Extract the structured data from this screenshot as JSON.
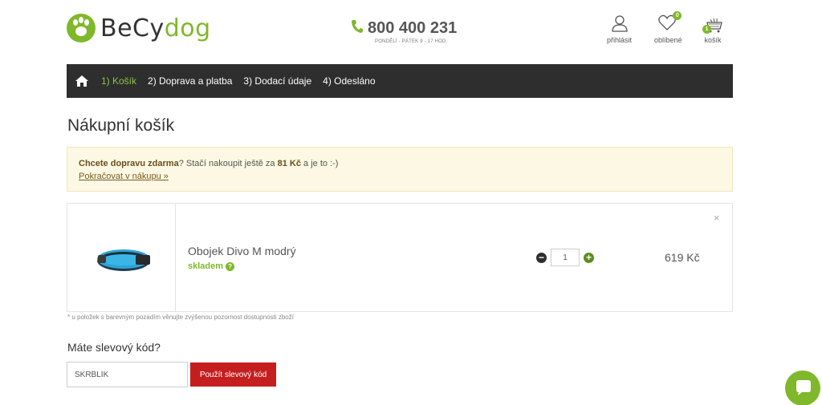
{
  "header": {
    "logo": {
      "text_main": "BeCy",
      "text_accent": "dog"
    },
    "phone": {
      "number": "800 400 231",
      "hours": "PONDĚLÍ - PÁTEK 9 - 17 HOD."
    },
    "user_nav": {
      "login_label": "přihlásit",
      "favorites_label": "oblíbené",
      "favorites_count": "0",
      "cart_label": "košík",
      "cart_count": "1"
    }
  },
  "steps": [
    "1) Košík",
    "2) Doprava a platba",
    "3) Dodací údaje",
    "4) Odesláno"
  ],
  "page_title": "Nákupní košík",
  "notice": {
    "bold_text": "Chcete dopravu zdarma",
    "text_before_amount": "? Stačí nakoupit ještě za ",
    "amount": "81 Kč",
    "text_after_amount": " a je to :-)",
    "link": "Pokračovat v nákupu »"
  },
  "cart": {
    "items": [
      {
        "name": "Obojek Divo M modrý",
        "stock": "skladem",
        "quantity": "1",
        "price": "619 Kč"
      }
    ],
    "remove_symbol": "×"
  },
  "availability_note": "* u položek s barevným pozadím věnujte zvýšenou pozornost dostupnosti zboží",
  "coupon": {
    "title": "Máte slevový kód?",
    "value": "SKRBLÍK",
    "button": "Použít slevový kód"
  },
  "colors": {
    "brand_green": "#7fb82a",
    "nav_dark": "#2e2e2e",
    "button_red": "#c41e1e",
    "notice_bg": "#fcf8e3"
  }
}
